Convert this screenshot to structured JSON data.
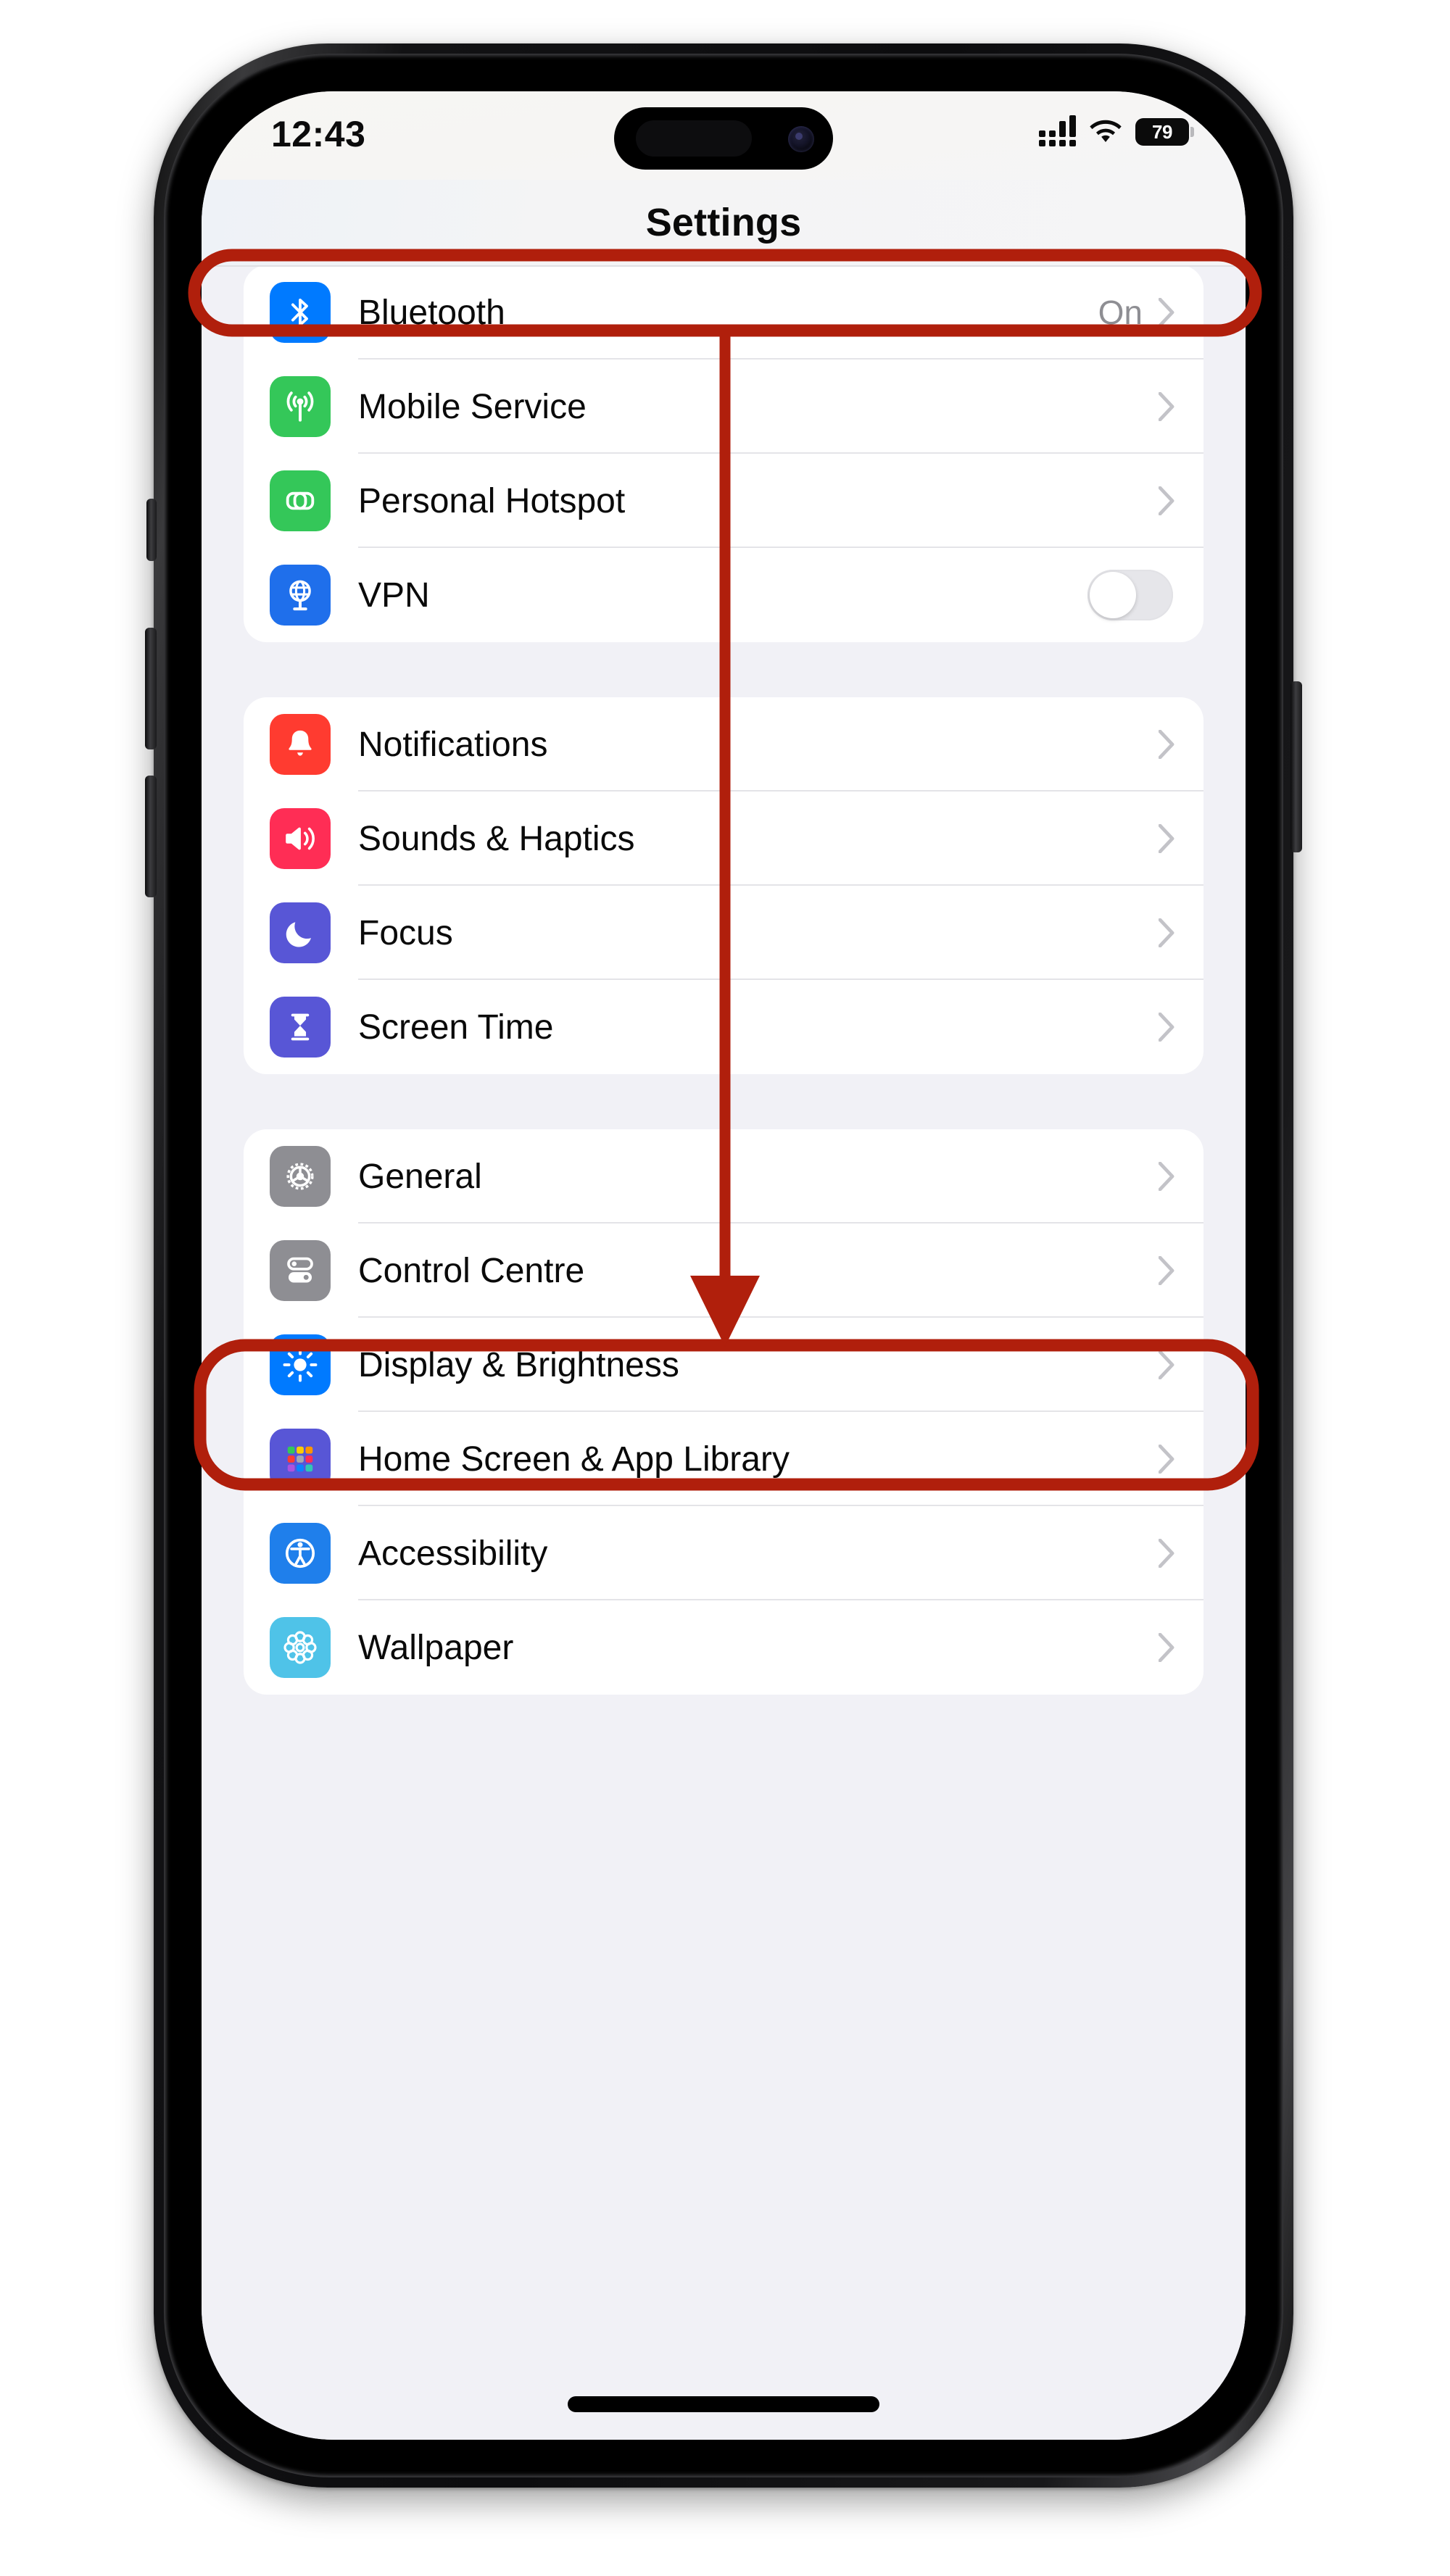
{
  "device": {
    "kind": "iphone",
    "status_bar": {
      "time": "12:43",
      "battery_percent": "79",
      "signal_icon": "cellular-signal-icon",
      "wifi_icon": "wifi-icon",
      "battery_icon": "battery-icon"
    }
  },
  "navbar": {
    "title": "Settings"
  },
  "accent": {
    "annotation_red": "#B01F0C",
    "ios_blue": "#007AFF",
    "ios_green": "#34C759",
    "ios_red": "#FF3B30",
    "ios_pink": "#FF2D55",
    "ios_purple": "#5856D6",
    "ios_grey": "#8E8E93",
    "ios_teal": "#4FC3E8",
    "screen_bg": "#F1F1F6",
    "row_bg": "#FFFFFF",
    "secondary_text": "#8E8E93"
  },
  "groups": [
    {
      "name": "connectivity",
      "rows": [
        {
          "label": "Bluetooth",
          "icon": "bluetooth-icon",
          "icon_color": "#007AFF",
          "value": "On",
          "accessory": "chevron"
        },
        {
          "label": "Mobile Service",
          "icon": "antenna-icon",
          "icon_color": "#34C759",
          "value": "",
          "accessory": "chevron"
        },
        {
          "label": "Personal Hotspot",
          "icon": "hotspot-link-icon",
          "icon_color": "#34C759",
          "value": "",
          "accessory": "chevron"
        },
        {
          "label": "VPN",
          "icon": "globe-vpn-icon",
          "icon_color": "#007AFF",
          "value": "",
          "accessory": "toggle",
          "toggle_on": false
        }
      ]
    },
    {
      "name": "alerts",
      "rows": [
        {
          "label": "Notifications",
          "icon": "bell-icon",
          "icon_color": "#FF3B30",
          "value": "",
          "accessory": "chevron"
        },
        {
          "label": "Sounds & Haptics",
          "icon": "speaker-wave-icon",
          "icon_color": "#FF2D55",
          "value": "",
          "accessory": "chevron"
        },
        {
          "label": "Focus",
          "icon": "moon-icon",
          "icon_color": "#5856D6",
          "value": "",
          "accessory": "chevron"
        },
        {
          "label": "Screen Time",
          "icon": "hourglass-icon",
          "icon_color": "#5856D6",
          "value": "",
          "accessory": "chevron"
        }
      ]
    },
    {
      "name": "system",
      "rows": [
        {
          "label": "General",
          "icon": "gear-icon",
          "icon_color": "#8E8E93",
          "value": "",
          "accessory": "chevron"
        },
        {
          "label": "Control Centre",
          "icon": "sliders-icon",
          "icon_color": "#8E8E93",
          "value": "",
          "accessory": "chevron"
        },
        {
          "label": "Display & Brightness",
          "icon": "brightness-sun-icon",
          "icon_color": "#007AFF",
          "value": "",
          "accessory": "chevron"
        },
        {
          "label": "Home Screen & App Library",
          "icon": "app-grid-icon",
          "icon_color": "#5856D6",
          "value": "",
          "accessory": "chevron"
        },
        {
          "label": "Accessibility",
          "icon": "accessibility-icon",
          "icon_color": "#007AFF",
          "value": "",
          "accessory": "chevron"
        },
        {
          "label": "Wallpaper",
          "icon": "flower-wallpaper-icon",
          "icon_color": "#4FC3E8",
          "value": "",
          "accessory": "chevron"
        }
      ]
    }
  ],
  "annotations": {
    "highlight_title": {
      "target": "Settings",
      "shape": "rounded-rect-outline"
    },
    "highlight_target": {
      "target": "Screen Time",
      "shape": "rounded-rect-outline"
    },
    "arrow": {
      "from": "Settings",
      "to": "Screen Time",
      "shape": "down-arrow"
    }
  }
}
